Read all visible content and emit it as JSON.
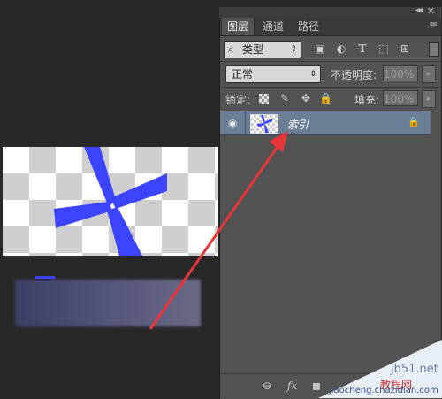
{
  "panel": {
    "tabs": [
      {
        "label": "图层",
        "active": true
      },
      {
        "label": "通道",
        "active": false
      },
      {
        "label": "路径",
        "active": false
      }
    ],
    "collapse_glyph": "◂◂",
    "close_glyph": "✕",
    "menu_glyph": "≡",
    "filter": {
      "search_glyph": "⌕",
      "kind_label": "类型",
      "arrow_glyph": "⇕",
      "icons": {
        "image": "▣",
        "adjust": "◐",
        "type": "T",
        "shape": "⬚",
        "smart": "⊞"
      }
    },
    "blend": {
      "mode": "正常",
      "arrow_glyph": "⇕",
      "opacity_label": "不透明度:",
      "opacity_value": "100%",
      "stepper_glyph": "▸"
    },
    "lock": {
      "label": "锁定:",
      "paint_glyph": "✎",
      "move_glyph": "✥",
      "all_glyph": "🔒",
      "fill_label": "填充:",
      "fill_value": "100%",
      "stepper_glyph": "▸"
    },
    "layers": [
      {
        "name": "索引",
        "visible": true,
        "locked": true,
        "eye_glyph": "◉",
        "lock_glyph": "🔒"
      }
    ],
    "bottom": {
      "link_glyph": "⊖",
      "fx_label": "fx",
      "mask_glyph": "◼"
    }
  },
  "watermark": {
    "site": "jb51.net",
    "label_cn": "教程网",
    "site2": "jiaocheng.chazidian.com"
  },
  "colors": {
    "selection": "#6c7d96",
    "arrow": "#e8353a",
    "shape_blue": "#3c44ff"
  }
}
